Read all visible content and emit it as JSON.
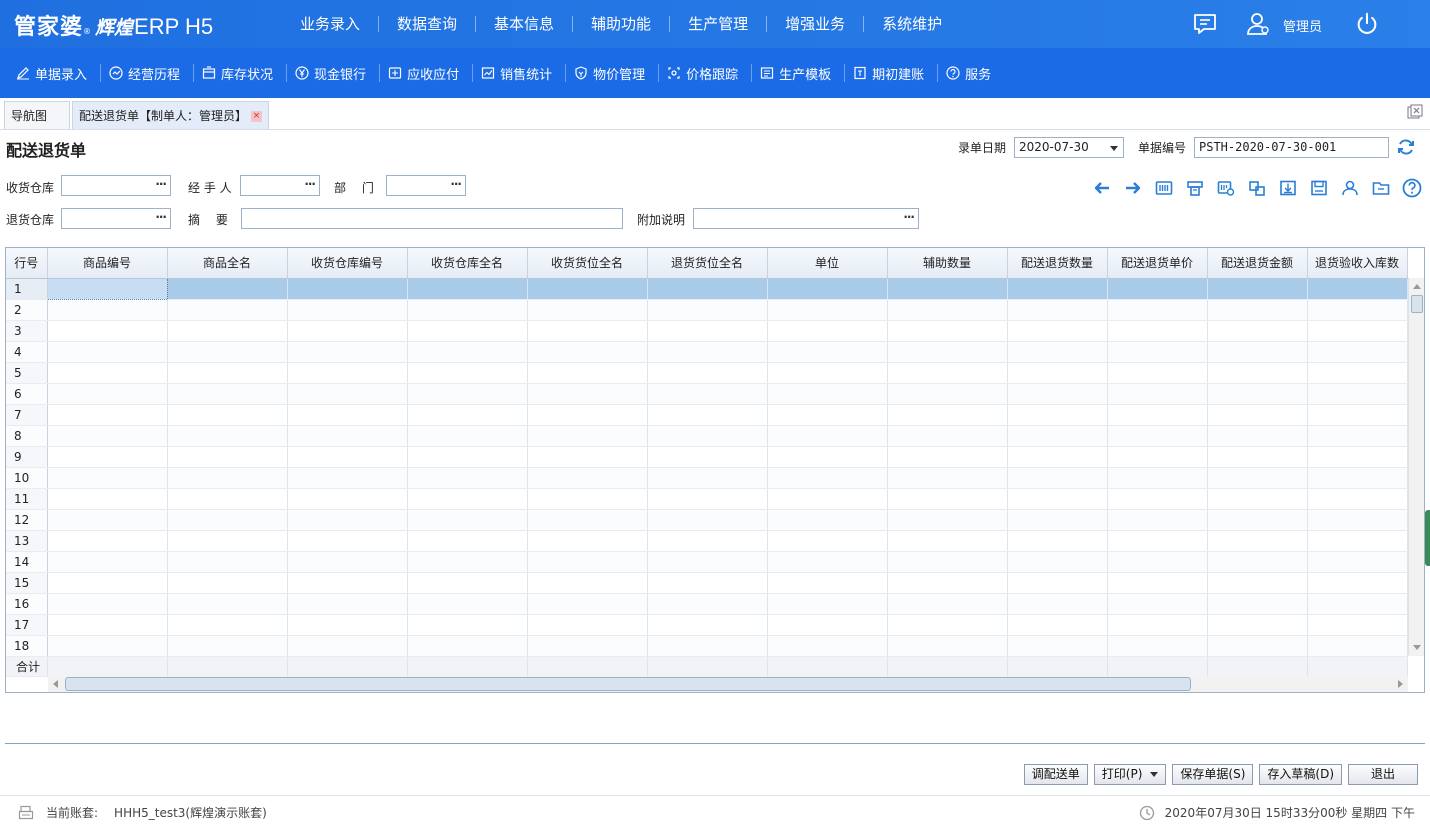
{
  "header": {
    "logo_main": "管家婆",
    "logo_reg": "®",
    "logo_sub": "辉煌",
    "logo_erp": "ERP H5",
    "nav": [
      "业务录入",
      "数据查询",
      "基本信息",
      "辅助功能",
      "生产管理",
      "增强业务",
      "系统维护"
    ],
    "user_name": "管理员",
    "icons": [
      "message-icon",
      "user-icon",
      "power-icon"
    ]
  },
  "toolbar": {
    "items": [
      {
        "label": "单据录入",
        "icon": "edit-icon"
      },
      {
        "label": "经营历程",
        "icon": "history-icon"
      },
      {
        "label": "库存状况",
        "icon": "inventory-icon"
      },
      {
        "label": "现金银行",
        "icon": "yuan-icon"
      },
      {
        "label": "应收应付",
        "icon": "ledger-icon"
      },
      {
        "label": "销售统计",
        "icon": "stats-icon"
      },
      {
        "label": "物价管理",
        "icon": "price-shield-icon"
      },
      {
        "label": "价格跟踪",
        "icon": "track-icon"
      },
      {
        "label": "生产模板",
        "icon": "template-icon"
      },
      {
        "label": "期初建账",
        "icon": "account-icon"
      },
      {
        "label": "服务",
        "icon": "help-icon"
      }
    ]
  },
  "tabs": [
    {
      "label": "导航图"
    },
    {
      "label": "配送退货单【制单人：管理员】",
      "close": "×"
    }
  ],
  "form": {
    "title": "配送退货单",
    "date_label": "录单日期",
    "date_value": "2020-07-30",
    "docno_label": "单据编号",
    "docno_value": "PSTH-2020-07-30-001",
    "recv_wh_label": "收货仓库",
    "handler_label": "经 手 人",
    "dept_label": "部　 门",
    "return_wh_label": "退货仓库",
    "summary_label": "摘　 要",
    "extra_label": "附加说明",
    "dots": "···"
  },
  "grid": {
    "columns": [
      "行号",
      "商品编号",
      "商品全名",
      "收货仓库编号",
      "收货仓库全名",
      "收货货位全名",
      "退货货位全名",
      "单位",
      "辅助数量",
      "配送退货数量",
      "配送退货单价",
      "配送退货金额",
      "退货验收入库数"
    ],
    "rows": [
      "1",
      "2",
      "3",
      "4",
      "5",
      "6",
      "7",
      "8",
      "9",
      "10",
      "11",
      "12",
      "13",
      "14",
      "15",
      "16",
      "17",
      "18"
    ],
    "total_label": "合计",
    "selected_row": 1
  },
  "buttons": {
    "transfer": "调配送单",
    "print": "打印(P)",
    "save": "保存单据(S)",
    "draft": "存入草稿(D)",
    "exit": "退出"
  },
  "status": {
    "account_label": "当前账套:",
    "account_value": "HHH5_test3(辉煌演示账套)",
    "datetime": "2020年07月30日 15时33分00秒 星期四 下午"
  },
  "colors": {
    "header_bg": "#1f6fe0",
    "toolbar_bg": "#1b6be6",
    "selected_row": "#a9cbea",
    "accent_icon": "#2a7fd4"
  }
}
